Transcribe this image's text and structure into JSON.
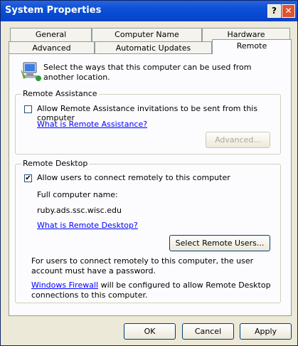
{
  "window": {
    "title": "System Properties"
  },
  "titlebar": {
    "help_label": "?",
    "close_label": "✕"
  },
  "tabs_row1": [
    "General",
    "Computer Name",
    "Hardware"
  ],
  "tabs_row2": [
    "Advanced",
    "Automatic Updates",
    "Remote"
  ],
  "intro": "Select the ways that this computer can be used from another location.",
  "remote_assistance": {
    "title": "Remote Assistance",
    "checkbox_label": "Allow Remote Assistance invitations to be sent from this computer",
    "checked": false,
    "link": "What is Remote Assistance?",
    "advanced_label": "Advanced..."
  },
  "remote_desktop": {
    "title": "Remote Desktop",
    "checkbox_label": "Allow users to connect remotely to this computer",
    "checked": true,
    "check_mark": "✔",
    "full_name_label": "Full computer name:",
    "computer_name": "ruby.ads.ssc.wisc.edu",
    "link": "What is Remote Desktop?",
    "select_users_label": "Select Remote Users...",
    "password_note": "For users to connect remotely to this computer, the user account must have a password.",
    "firewall_link": "Windows Firewall",
    "firewall_note": " will be configured to allow Remote Desktop connections to this computer."
  },
  "footer": {
    "ok_label": "OK",
    "cancel_label": "Cancel",
    "apply_label": "Apply"
  }
}
